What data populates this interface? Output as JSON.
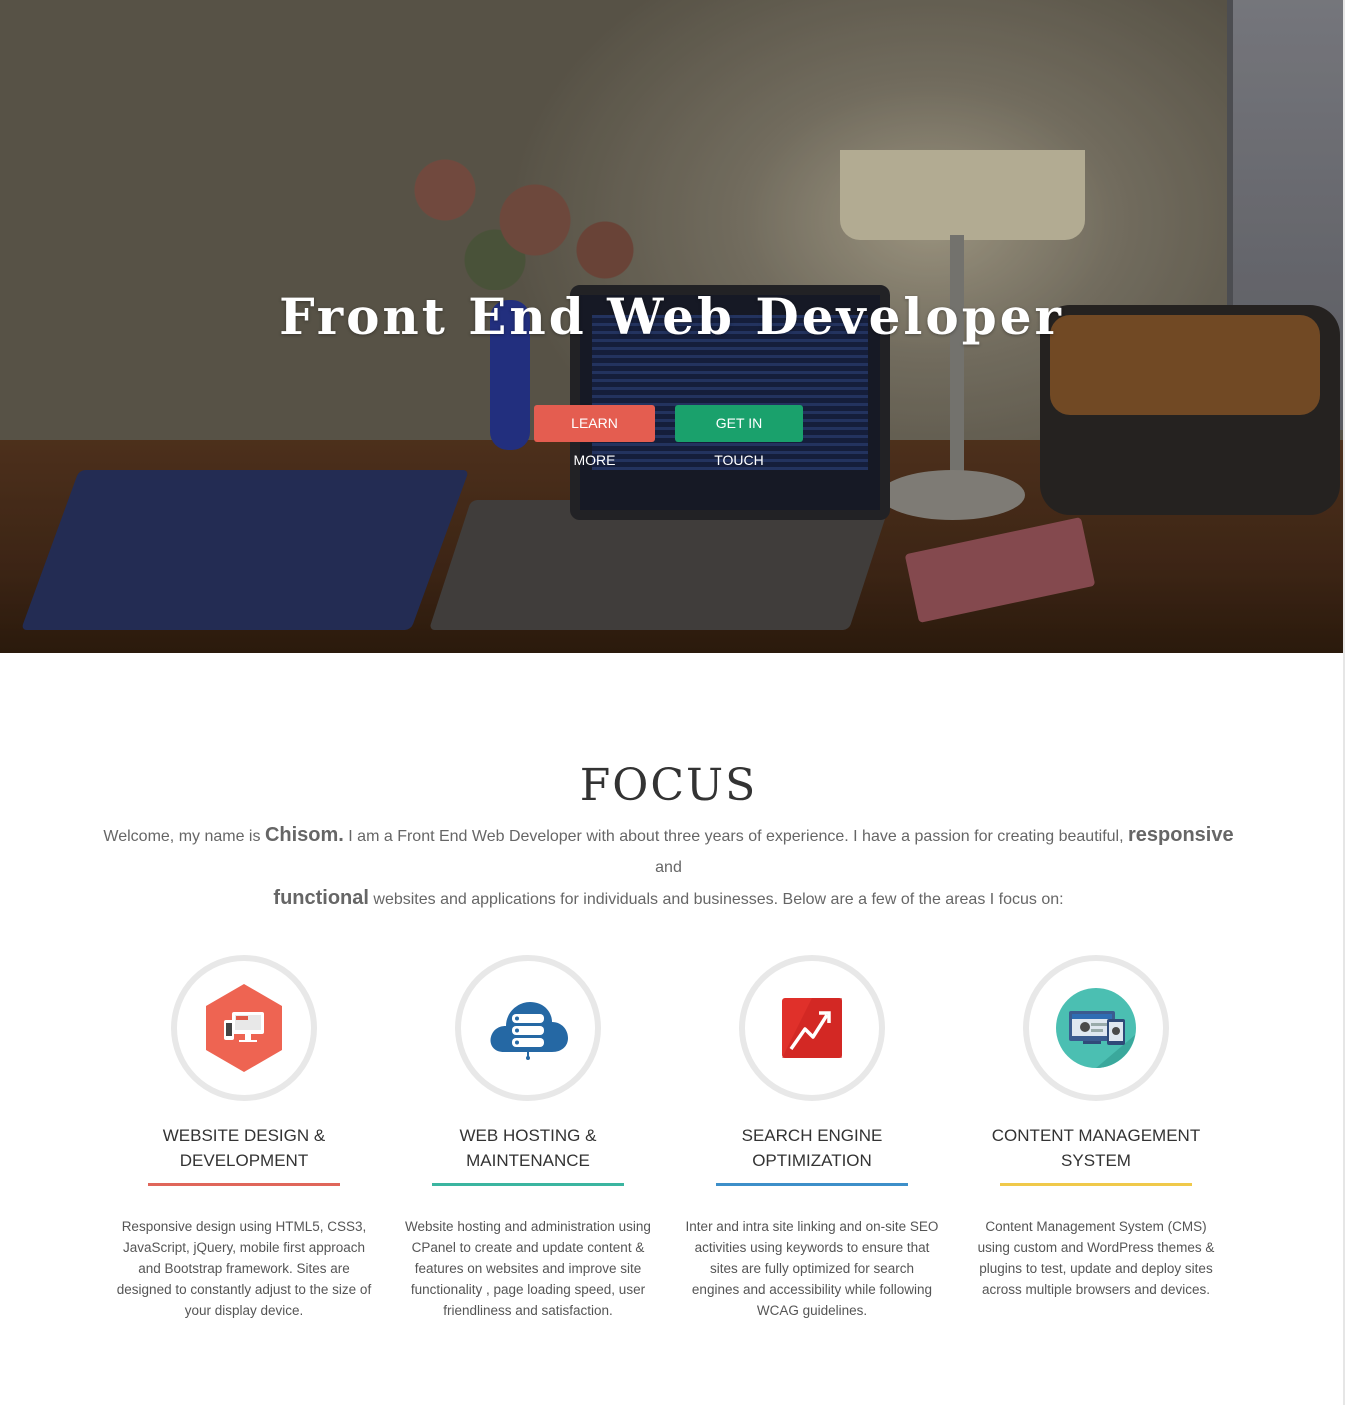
{
  "hero": {
    "title": "Front End Web Developer",
    "learn_more": "LEARN MORE",
    "get_in_touch": "GET IN TOUCH"
  },
  "focus": {
    "title": "FOCUS",
    "intro": {
      "part1": "Welcome, my name is ",
      "name": "Chisom.",
      "part2": " I am a Front End Web Developer with about three years of experience. I have a passion for creating beautiful, ",
      "responsive": "responsive",
      "part3": " and ",
      "functional": "functional",
      "part4": " websites and applications for individuals and businesses. Below are a few of the areas I focus on:"
    },
    "cards": [
      {
        "title_line1": "WEBSITE DESIGN &",
        "title_line2": "DEVELOPMENT",
        "description": "Responsive design using HTML5, CSS3, JavaScript, jQuery, mobile first approach and Bootstrap framework. Sites are designed to constantly adjust to the size of your display device.",
        "icon": "responsive-devices-icon",
        "accent": "#e0665a"
      },
      {
        "title_line1": "WEB HOSTING &",
        "title_line2": "MAINTENANCE",
        "description": "Website hosting and administration using CPanel to create and update content & features on websites and improve site functionality , page loading speed, user friendliness and satisfaction.",
        "icon": "cloud-server-icon",
        "accent": "#3bb5a0"
      },
      {
        "title_line1": "SEARCH ENGINE",
        "title_line2": "OPTIMIZATION",
        "description": "Inter and intra site linking and on-site SEO activities using keywords to ensure that sites are fully optimized for search engines and accessibility while following WCAG guidelines.",
        "icon": "seo-trend-icon",
        "accent": "#3d8fc9"
      },
      {
        "title_line1": "CONTENT MANAGEMENT",
        "title_line2": "SYSTEM",
        "description": "Content Management System (CMS) using custom and WordPress themes & plugins to test, update and deploy sites across multiple browsers and devices.",
        "icon": "wordpress-devices-icon",
        "accent": "#f0c94a"
      }
    ]
  }
}
